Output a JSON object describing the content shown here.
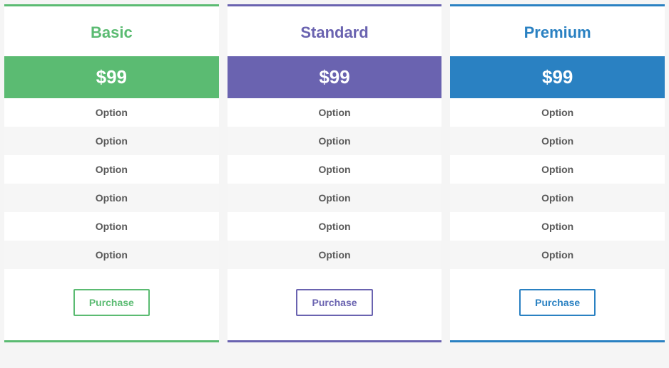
{
  "plans": [
    {
      "key": "basic",
      "title": "Basic",
      "price": "$99",
      "features": [
        "Option",
        "Option",
        "Option",
        "Option",
        "Option",
        "Option"
      ],
      "cta": "Purchase"
    },
    {
      "key": "standard",
      "title": "Standard",
      "price": "$99",
      "features": [
        "Option",
        "Option",
        "Option",
        "Option",
        "Option",
        "Option"
      ],
      "cta": "Purchase"
    },
    {
      "key": "premium",
      "title": "Premium",
      "price": "$99",
      "features": [
        "Option",
        "Option",
        "Option",
        "Option",
        "Option",
        "Option"
      ],
      "cta": "Purchase"
    }
  ]
}
